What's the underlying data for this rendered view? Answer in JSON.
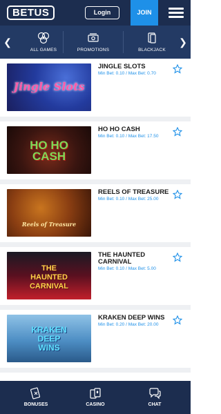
{
  "header": {
    "logo": "BETUS",
    "login_label": "Login",
    "join_label": "JOIN"
  },
  "categories": [
    {
      "label": "ALL GAMES",
      "icon": "casino-chips-icon"
    },
    {
      "label": "PROMOTIONS",
      "icon": "money-icon"
    },
    {
      "label": "BLACKJACK",
      "icon": "cards-icon"
    }
  ],
  "games": [
    {
      "title": "JINGLE SLOTS",
      "bets": "Min Bet: 0.10 / Max Bet: 0.70",
      "thumb_text": "Jingle Slots"
    },
    {
      "title": "HO HO CASH",
      "bets": "Min Bet: 0.10 / Max Bet: 17.50",
      "thumb_text": "HO HO CASH"
    },
    {
      "title": "REELS OF TREASURE",
      "bets": "Min Bet: 0.10 / Max Bet: 25.00",
      "thumb_text": "Reels of Treasure"
    },
    {
      "title": "THE HAUNTED CARNIVAL",
      "bets": "Min Bet: 0.10 / Max Bet: 5.00",
      "thumb_text": "THE HAUNTED CARNIVAL"
    },
    {
      "title": "KRAKEN DEEP WINS",
      "bets": "Min Bet: 0.20 / Max Bet: 20.00",
      "thumb_text": "KRAKEN DEEP WINS"
    }
  ],
  "bottom_nav": [
    {
      "label": "BONUSES",
      "icon": "bonus-card-icon"
    },
    {
      "label": "CASINO",
      "icon": "playing-cards-icon"
    },
    {
      "label": "CHAT",
      "icon": "chat-bubble-icon"
    }
  ],
  "colors": {
    "header_bg": "#1c2d4f",
    "nav_bg": "#233a64",
    "accent": "#1e90e8"
  }
}
